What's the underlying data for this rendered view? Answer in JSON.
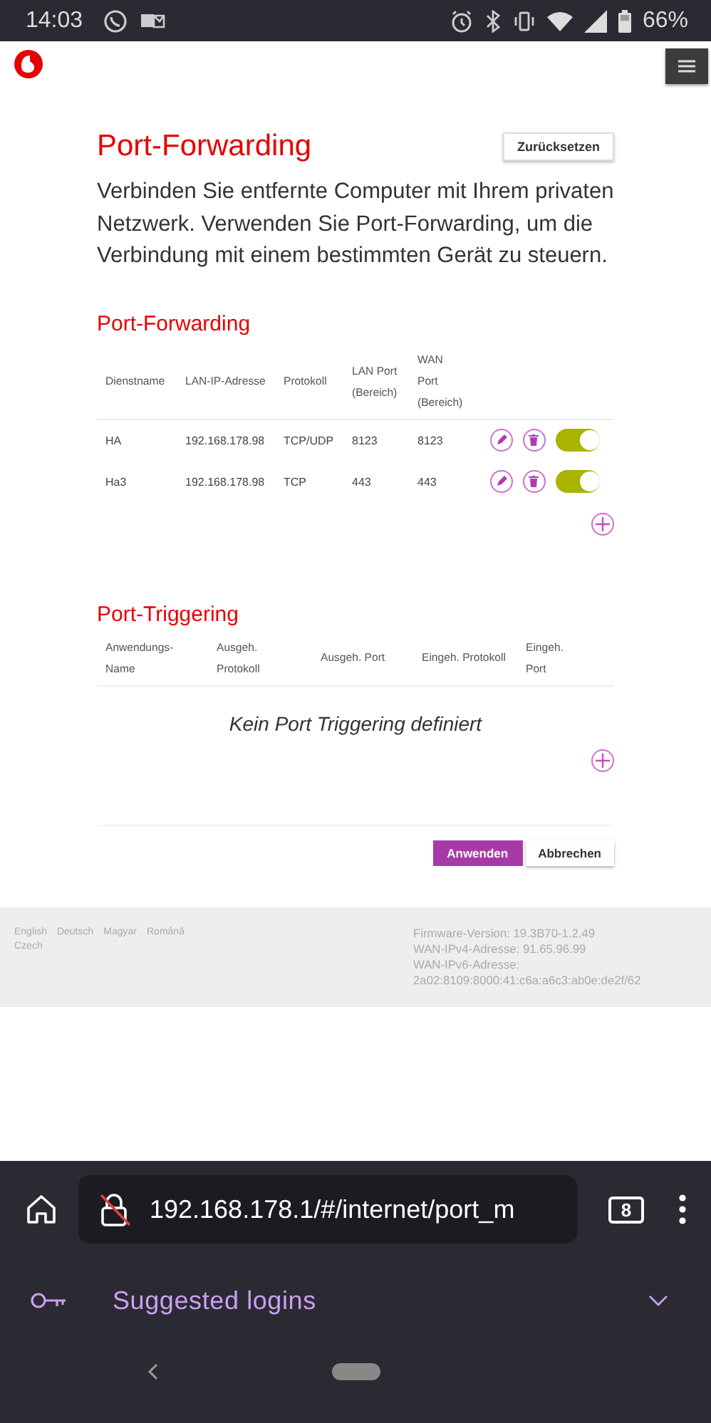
{
  "status_bar": {
    "time": "14:03",
    "battery": "66%"
  },
  "page": {
    "title": "Port-Forwarding",
    "reset_button": "Zurücksetzen",
    "description": "Verbinden Sie entfernte Computer mit Ihrem privaten Netzwerk. Verwenden Sie Port-Forwarding, um die Verbindung mit einem bestimmten Gerät zu steuern.",
    "port_forwarding": {
      "heading": "Port-Forwarding",
      "columns": [
        "Dienstname",
        "LAN-IP-Adresse",
        "Protokoll",
        "LAN Port (Bereich)",
        "WAN Port (Bereich)"
      ],
      "rows": [
        {
          "name": "HA",
          "ip": "192.168.178.98",
          "protocol": "TCP/UDP",
          "lan_port": "8123",
          "wan_port": "8123",
          "enabled": true
        },
        {
          "name": "Ha3",
          "ip": "192.168.178.98",
          "protocol": "TCP",
          "lan_port": "443",
          "wan_port": "443",
          "enabled": true
        }
      ]
    },
    "port_triggering": {
      "heading": "Port-Triggering",
      "columns": [
        "Anwendungs-Name",
        "Ausgeh. Protokoll",
        "Ausgeh. Port",
        "Eingeh. Protokoll",
        "Eingeh. Port"
      ],
      "empty_message": "Kein Port Triggering definiert"
    },
    "buttons": {
      "apply": "Anwenden",
      "cancel": "Abbrechen"
    }
  },
  "footer": {
    "languages": [
      "English",
      "Deutsch",
      "Magyar",
      "Română",
      "Czech"
    ],
    "info": [
      "Firmware-Version: 19.3B70-1.2.49",
      "WAN-IPv4-Adresse: 91.65.96.99",
      "WAN-IPv6-Adresse:",
      "2a02:8109:8000:41:c6a:a6c3:ab0e:de2f/62"
    ]
  },
  "browser": {
    "url": "192.168.178.1/#/internet/port_m",
    "tab_count": "8",
    "suggestion": "Suggested logins"
  }
}
